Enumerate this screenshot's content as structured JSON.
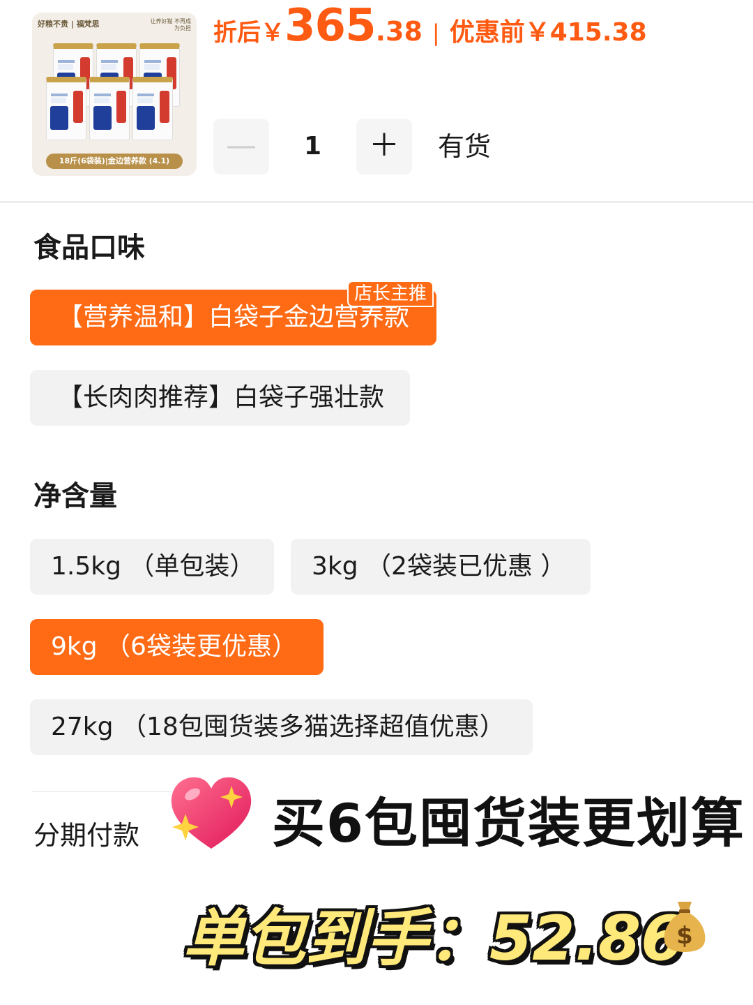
{
  "product": {
    "brand_left": "好粮不贵 | 福梵思",
    "brand_right": "让养好猫 不再成为负担",
    "pill_text": "18斤(6袋装)|金边营养款 (4.1)"
  },
  "price": {
    "after_label": "折后￥",
    "after_int": "365",
    "after_dec": ".38",
    "separator": "|",
    "before_label": "优惠前￥415.38"
  },
  "quantity": {
    "minus": "—",
    "value": "1",
    "plus": "＋",
    "stock": "有货"
  },
  "flavor": {
    "title": "食品口味",
    "badge": "店长主推",
    "options": [
      {
        "label": "【营养温和】白袋子金边营养款",
        "selected": true
      },
      {
        "label": "【长肉肉推荐】白袋子强壮款",
        "selected": false
      }
    ]
  },
  "weight": {
    "title": "净含量",
    "options": [
      {
        "label": "1.5kg （单包装）",
        "selected": false
      },
      {
        "label": "3kg （2袋装已优惠 ）",
        "selected": false
      },
      {
        "label": "9kg （6袋装更优惠）",
        "selected": true
      },
      {
        "label": "27kg （18包囤货装多猫选择超值优惠）",
        "selected": false
      }
    ]
  },
  "installment": {
    "title": "分期付款"
  },
  "overlay": {
    "promo": "买6包囤货装更划算",
    "final": "单包到手：52.86"
  },
  "colors": {
    "accent": "#ff6a14",
    "price": "#ff5a12",
    "option_bg": "#f2f2f2"
  },
  "icons": [
    "sparkling-heart-icon",
    "money-bag-icon",
    "minus-icon",
    "plus-icon"
  ]
}
